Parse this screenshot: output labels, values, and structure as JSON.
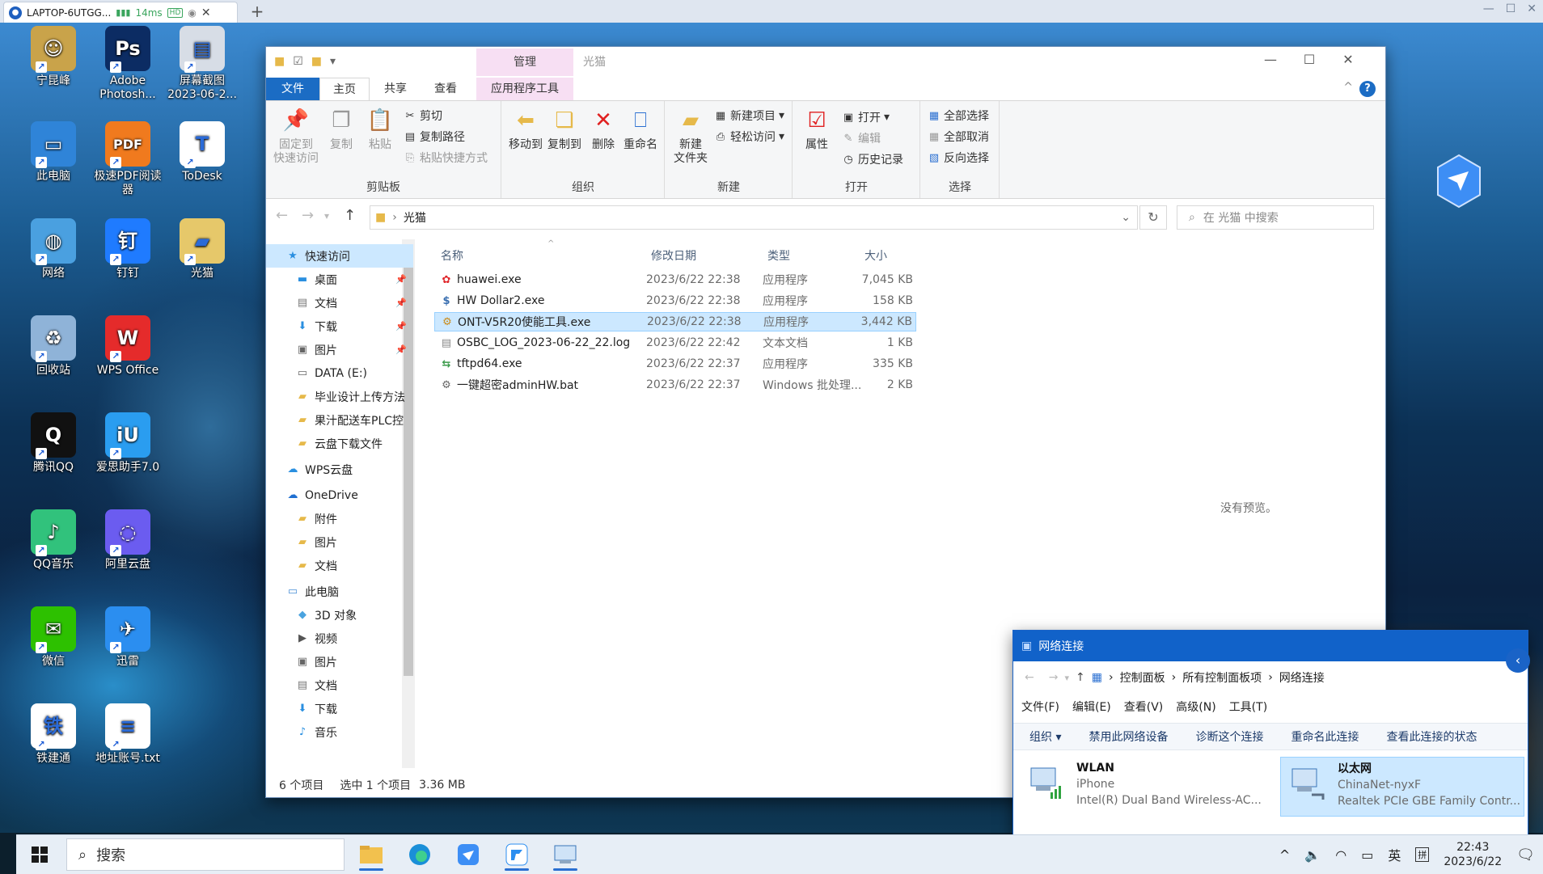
{
  "remote_bar": {
    "tab_title": "LAPTOP-6UTGG...",
    "latency": "14ms",
    "quality_badge": "HD"
  },
  "desktop_icons": [
    {
      "label": "宁昆峰",
      "icon": "user-folder-icon",
      "color": "#c9a34a"
    },
    {
      "label": "Adobe Photosh...",
      "icon": "photoshop-icon",
      "color": "#0c2c63"
    },
    {
      "label": "屏幕截图 2023-06-2...",
      "icon": "screenshot-image-icon",
      "color": "#d7dde6"
    },
    {
      "label": "此电脑",
      "icon": "computer-icon",
      "color": "#2f84d8"
    },
    {
      "label": "极速PDF阅读器",
      "icon": "pdf-reader-icon",
      "color": "#f07a1e"
    },
    {
      "label": "ToDesk",
      "icon": "todesk-icon",
      "color": "#ffffff"
    },
    {
      "label": "网络",
      "icon": "network-icon",
      "color": "#4aa0e0"
    },
    {
      "label": "钉钉",
      "icon": "dingtalk-icon",
      "color": "#1f7bff"
    },
    {
      "label": "光猫",
      "icon": "folder-icon",
      "color": "#e6c86a"
    },
    {
      "label": "回收站",
      "icon": "recycle-bin-icon",
      "color": "#8fb3d8"
    },
    {
      "label": "WPS Office",
      "icon": "wps-icon",
      "color": "#e52b2b"
    },
    {
      "label": "腾讯QQ",
      "icon": "qq-penguin-icon",
      "color": "#111111"
    },
    {
      "label": "爱思助手7.0",
      "icon": "i4-assistant-icon",
      "color": "#2a9df0"
    },
    {
      "label": "QQ音乐",
      "icon": "qq-music-icon",
      "color": "#31c27c"
    },
    {
      "label": "阿里云盘",
      "icon": "aliyun-drive-icon",
      "color": "#6b5cf0"
    },
    {
      "label": "微信",
      "icon": "wechat-icon",
      "color": "#2dc100"
    },
    {
      "label": "迅雷",
      "icon": "xunlei-icon",
      "color": "#2b8ef0"
    },
    {
      "label": "铁建通",
      "icon": "tiejiantong-icon",
      "color": "#ffffff"
    },
    {
      "label": "地址账号.txt",
      "icon": "text-file-icon",
      "color": "#ffffff"
    }
  ],
  "explorer": {
    "title": "光猫",
    "manage_tab": "管理",
    "tabs": {
      "file": "文件",
      "home": "主页",
      "share": "共享",
      "view": "查看",
      "app_tools": "应用程序工具"
    },
    "ribbon": {
      "clipboard": {
        "label": "剪贴板",
        "pin": "固定到\n快速访问",
        "copy": "复制",
        "paste": "粘贴",
        "cut": "剪切",
        "copy_path": "复制路径",
        "paste_shortcut": "粘贴快捷方式"
      },
      "organize": {
        "label": "组织",
        "move_to": "移动到",
        "copy_to": "复制到",
        "delete": "删除",
        "rename": "重命名"
      },
      "new": {
        "label": "新建",
        "new_folder": "新建\n文件夹",
        "new_item": "新建项目",
        "easy_access": "轻松访问"
      },
      "open": {
        "label": "打开",
        "properties": "属性",
        "open": "打开",
        "edit": "编辑",
        "history": "历史记录"
      },
      "select": {
        "label": "选择",
        "select_all": "全部选择",
        "select_none": "全部取消",
        "invert": "反向选择"
      }
    },
    "address": {
      "path": "光猫",
      "search_placeholder": "在 光猫 中搜索"
    },
    "nav": [
      {
        "label": "快速访问",
        "icon": "star-icon",
        "indent": 0,
        "selected": true,
        "pinned": false
      },
      {
        "label": "桌面",
        "icon": "desktop-icon",
        "indent": 1,
        "pinned": true
      },
      {
        "label": "文档",
        "icon": "document-icon",
        "indent": 1,
        "pinned": true
      },
      {
        "label": "下载",
        "icon": "download-icon",
        "indent": 1,
        "pinned": true
      },
      {
        "label": "图片",
        "icon": "pictures-icon",
        "indent": 1,
        "pinned": true
      },
      {
        "label": "DATA (E:)",
        "icon": "drive-icon",
        "indent": 1,
        "pinned": false
      },
      {
        "label": "毕业设计上传方法",
        "icon": "folder-icon",
        "indent": 1,
        "pinned": false
      },
      {
        "label": "果汁配送车PLC控",
        "icon": "folder-icon",
        "indent": 1,
        "pinned": false
      },
      {
        "label": "云盘下载文件",
        "icon": "folder-icon",
        "indent": 1,
        "pinned": false
      },
      {
        "label": "WPS云盘",
        "icon": "cloud-icon",
        "indent": 0,
        "pinned": false
      },
      {
        "label": "OneDrive",
        "icon": "onedrive-icon",
        "indent": 0,
        "pinned": false
      },
      {
        "label": "附件",
        "icon": "folder-icon",
        "indent": 1,
        "pinned": false
      },
      {
        "label": "图片",
        "icon": "folder-icon",
        "indent": 1,
        "pinned": false
      },
      {
        "label": "文档",
        "icon": "folder-icon",
        "indent": 1,
        "pinned": false
      },
      {
        "label": "此电脑",
        "icon": "computer-icon",
        "indent": 0,
        "pinned": false
      },
      {
        "label": "3D 对象",
        "icon": "3d-objects-icon",
        "indent": 1,
        "pinned": false
      },
      {
        "label": "视频",
        "icon": "video-icon",
        "indent": 1,
        "pinned": false
      },
      {
        "label": "图片",
        "icon": "pictures-icon",
        "indent": 1,
        "pinned": false
      },
      {
        "label": "文档",
        "icon": "document-icon",
        "indent": 1,
        "pinned": false
      },
      {
        "label": "下载",
        "icon": "download-icon",
        "indent": 1,
        "pinned": false
      },
      {
        "label": "音乐",
        "icon": "music-icon",
        "indent": 1,
        "pinned": false
      }
    ],
    "columns": {
      "name": "名称",
      "modified": "修改日期",
      "type": "类型",
      "size": "大小"
    },
    "files": [
      {
        "name": "huawei.exe",
        "modified": "2023/6/22 22:38",
        "type": "应用程序",
        "size": "7,045 KB",
        "icon": "huawei-icon",
        "selected": false
      },
      {
        "name": "HW Dollar2.exe",
        "modified": "2023/6/22 22:38",
        "type": "应用程序",
        "size": "158 KB",
        "icon": "dollar-app-icon",
        "selected": false
      },
      {
        "name": "ONT-V5R20使能工具.exe",
        "modified": "2023/6/22 22:38",
        "type": "应用程序",
        "size": "3,442 KB",
        "icon": "tool-app-icon",
        "selected": true
      },
      {
        "name": "OSBC_LOG_2023-06-22_22.log",
        "modified": "2023/6/22 22:42",
        "type": "文本文档",
        "size": "1 KB",
        "icon": "text-doc-icon",
        "selected": false
      },
      {
        "name": "tftpd64.exe",
        "modified": "2023/6/22 22:37",
        "type": "应用程序",
        "size": "335 KB",
        "icon": "tftpd-icon",
        "selected": false
      },
      {
        "name": "一键超密adminHW.bat",
        "modified": "2023/6/22 22:37",
        "type": "Windows 批处理...",
        "size": "2 KB",
        "icon": "batch-file-icon",
        "selected": false
      }
    ],
    "preview_text": "没有预览。",
    "status": {
      "count": "6 个项目",
      "selected": "选中 1 个项目",
      "size": "3.36 MB"
    }
  },
  "network_window": {
    "title": "网络连接",
    "breadcrumb": [
      "控制面板",
      "所有控制面板项",
      "网络连接"
    ],
    "menu": [
      "文件(F)",
      "编辑(E)",
      "查看(V)",
      "高级(N)",
      "工具(T)"
    ],
    "commands": [
      "组织 ▾",
      "禁用此网络设备",
      "诊断这个连接",
      "重命名此连接",
      "查看此连接的状态"
    ],
    "adapters": [
      {
        "name": "WLAN",
        "network": "iPhone",
        "device": "Intel(R) Dual Band Wireless-AC...",
        "selected": false
      },
      {
        "name": "以太网",
        "network": "ChinaNet-nyxF",
        "device": "Realtek PCIe GBE Family Contr...",
        "selected": true
      }
    ]
  },
  "taskbar": {
    "search_placeholder": "搜索",
    "ime": "英",
    "ime2": "拼",
    "time": "22:43",
    "date": "2023/6/22"
  }
}
